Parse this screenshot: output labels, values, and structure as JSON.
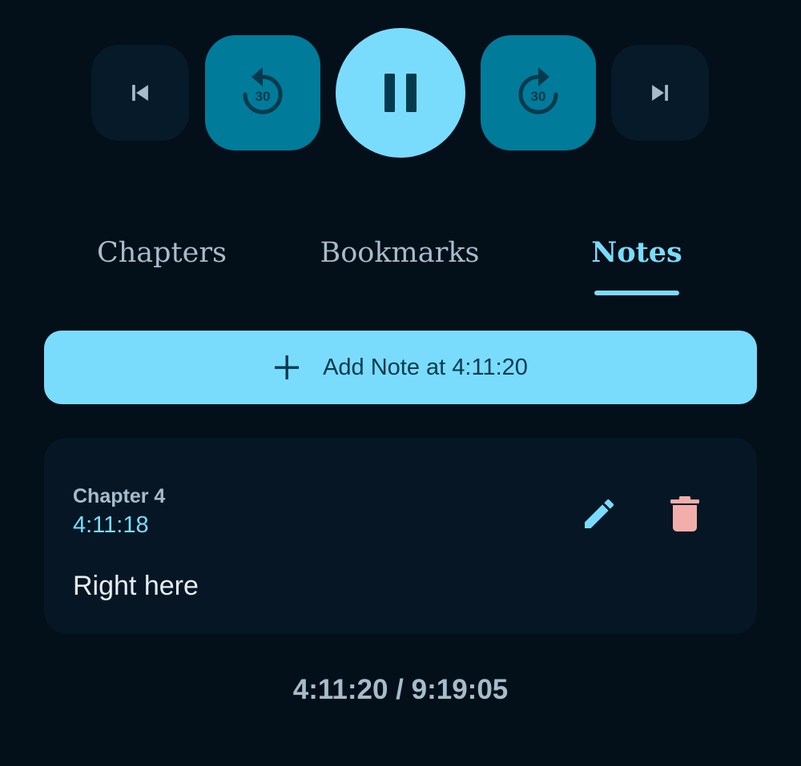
{
  "controls": {
    "previous_icon": "skip-previous-icon",
    "rewind_icon": "replay-30-icon",
    "rewind_seconds": "30",
    "play_pause_icon": "pause-icon",
    "forward_icon": "forward-30-icon",
    "forward_seconds": "30",
    "next_icon": "skip-next-icon"
  },
  "tabs": [
    {
      "label": "Chapters",
      "active": false
    },
    {
      "label": "Bookmarks",
      "active": false
    },
    {
      "label": "Notes",
      "active": true
    }
  ],
  "add_note": {
    "icon": "plus-icon",
    "label": "Add Note at 4:11:20"
  },
  "notes": [
    {
      "chapter": "Chapter 4",
      "timestamp": "4:11:18",
      "text": "Right here",
      "edit_icon": "pencil-icon",
      "delete_icon": "trash-icon"
    }
  ],
  "progress": {
    "display": "4:11:20 / 9:19:05"
  },
  "colors": {
    "background": "#030f19",
    "accent": "#79dcfd",
    "accent_dark": "#007b9a",
    "surface": "#061624",
    "muted_text": "#a6bccb",
    "delete": "#f2aeab"
  }
}
